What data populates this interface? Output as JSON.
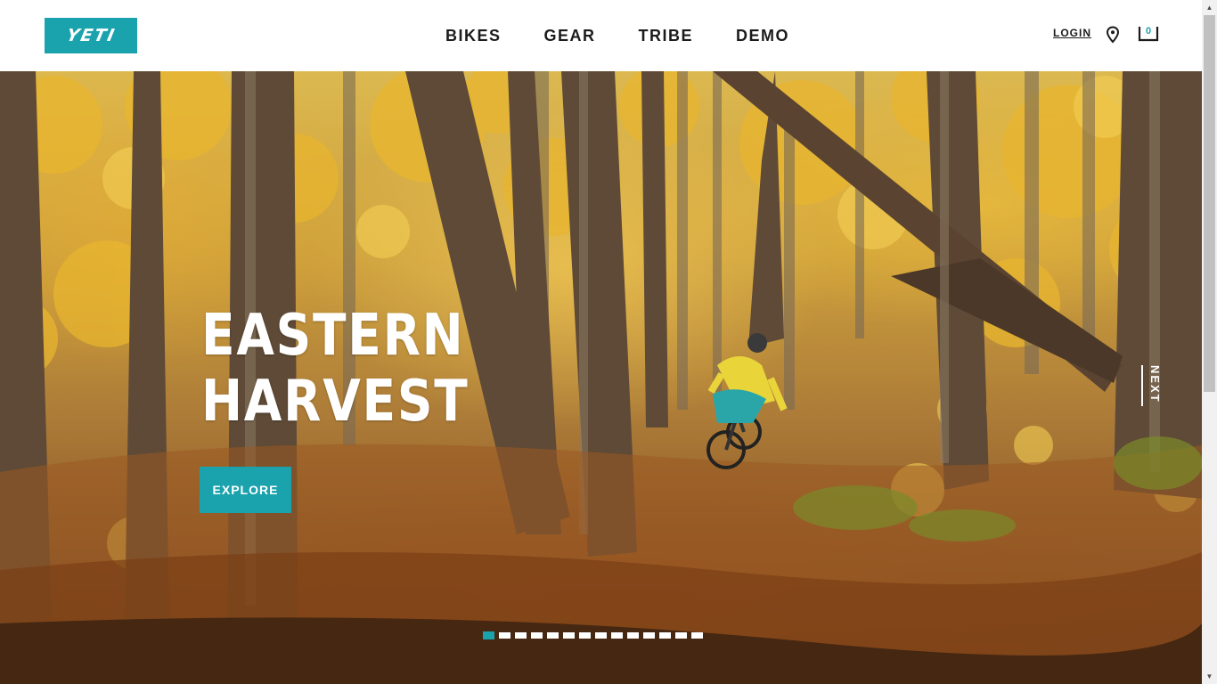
{
  "header": {
    "logo_text": "YETI",
    "nav": [
      {
        "label": "BIKES"
      },
      {
        "label": "GEAR"
      },
      {
        "label": "TRIBE"
      },
      {
        "label": "DEMO"
      }
    ],
    "login_label": "LOGIN",
    "location_icon": "map-pin-icon",
    "cart_icon": "cart-icon",
    "cart_count": "0"
  },
  "hero": {
    "headline_line1": "EASTERN",
    "headline_line2": "HARVEST",
    "cta_label": "EXPLORE",
    "next_label": "NEXT",
    "slides_total": 14,
    "active_slide": 1
  },
  "colors": {
    "brand": "#1aa3ad",
    "text_dark": "#1b1b1b",
    "white": "#ffffff"
  }
}
